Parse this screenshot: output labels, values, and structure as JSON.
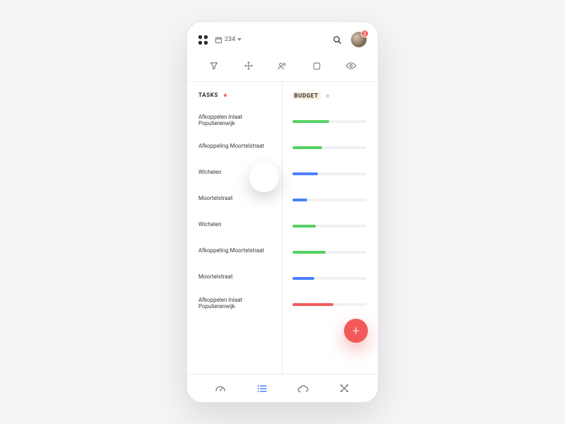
{
  "header": {
    "calendar_count": "234",
    "notification_count": "2"
  },
  "columns": {
    "tasks_label": "TASKS",
    "budget_label": "BUDGET"
  },
  "tasks": [
    {
      "name": "Afkoppelen Inlaat Populierenwijk",
      "color": "green",
      "pct": 50
    },
    {
      "name": "Afkoppeling Moortelstraat",
      "color": "green",
      "pct": 40
    },
    {
      "name": "Wichelen",
      "color": "blue",
      "pct": 35
    },
    {
      "name": "Moortelstraat",
      "color": "blue",
      "pct": 20
    },
    {
      "name": "Wichelen",
      "color": "green",
      "pct": 32
    },
    {
      "name": "Afkoppeling Moortelstraat",
      "color": "green",
      "pct": 45
    },
    {
      "name": "Moortelstraat",
      "color": "blue",
      "pct": 30
    },
    {
      "name": "Afkoppelen Inlaat Populierenwijk",
      "color": "red",
      "pct": 55
    }
  ],
  "fab_label": "+"
}
